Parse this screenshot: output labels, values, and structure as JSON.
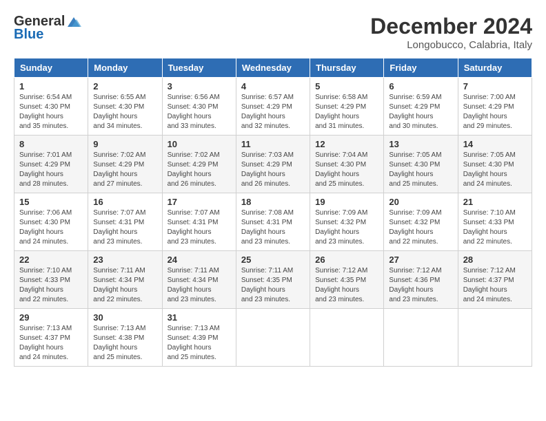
{
  "logo": {
    "general": "General",
    "blue": "Blue"
  },
  "header": {
    "month": "December 2024",
    "location": "Longobucco, Calabria, Italy"
  },
  "weekdays": [
    "Sunday",
    "Monday",
    "Tuesday",
    "Wednesday",
    "Thursday",
    "Friday",
    "Saturday"
  ],
  "weeks": [
    [
      {
        "day": "1",
        "sunrise": "6:54 AM",
        "sunset": "4:30 PM",
        "daylight": "9 hours and 35 minutes."
      },
      {
        "day": "2",
        "sunrise": "6:55 AM",
        "sunset": "4:30 PM",
        "daylight": "9 hours and 34 minutes."
      },
      {
        "day": "3",
        "sunrise": "6:56 AM",
        "sunset": "4:30 PM",
        "daylight": "9 hours and 33 minutes."
      },
      {
        "day": "4",
        "sunrise": "6:57 AM",
        "sunset": "4:29 PM",
        "daylight": "9 hours and 32 minutes."
      },
      {
        "day": "5",
        "sunrise": "6:58 AM",
        "sunset": "4:29 PM",
        "daylight": "9 hours and 31 minutes."
      },
      {
        "day": "6",
        "sunrise": "6:59 AM",
        "sunset": "4:29 PM",
        "daylight": "9 hours and 30 minutes."
      },
      {
        "day": "7",
        "sunrise": "7:00 AM",
        "sunset": "4:29 PM",
        "daylight": "9 hours and 29 minutes."
      }
    ],
    [
      {
        "day": "8",
        "sunrise": "7:01 AM",
        "sunset": "4:29 PM",
        "daylight": "9 hours and 28 minutes."
      },
      {
        "day": "9",
        "sunrise": "7:02 AM",
        "sunset": "4:29 PM",
        "daylight": "9 hours and 27 minutes."
      },
      {
        "day": "10",
        "sunrise": "7:02 AM",
        "sunset": "4:29 PM",
        "daylight": "9 hours and 26 minutes."
      },
      {
        "day": "11",
        "sunrise": "7:03 AM",
        "sunset": "4:29 PM",
        "daylight": "9 hours and 26 minutes."
      },
      {
        "day": "12",
        "sunrise": "7:04 AM",
        "sunset": "4:30 PM",
        "daylight": "9 hours and 25 minutes."
      },
      {
        "day": "13",
        "sunrise": "7:05 AM",
        "sunset": "4:30 PM",
        "daylight": "9 hours and 25 minutes."
      },
      {
        "day": "14",
        "sunrise": "7:05 AM",
        "sunset": "4:30 PM",
        "daylight": "9 hours and 24 minutes."
      }
    ],
    [
      {
        "day": "15",
        "sunrise": "7:06 AM",
        "sunset": "4:30 PM",
        "daylight": "9 hours and 24 minutes."
      },
      {
        "day": "16",
        "sunrise": "7:07 AM",
        "sunset": "4:31 PM",
        "daylight": "9 hours and 23 minutes."
      },
      {
        "day": "17",
        "sunrise": "7:07 AM",
        "sunset": "4:31 PM",
        "daylight": "9 hours and 23 minutes."
      },
      {
        "day": "18",
        "sunrise": "7:08 AM",
        "sunset": "4:31 PM",
        "daylight": "9 hours and 23 minutes."
      },
      {
        "day": "19",
        "sunrise": "7:09 AM",
        "sunset": "4:32 PM",
        "daylight": "9 hours and 23 minutes."
      },
      {
        "day": "20",
        "sunrise": "7:09 AM",
        "sunset": "4:32 PM",
        "daylight": "9 hours and 22 minutes."
      },
      {
        "day": "21",
        "sunrise": "7:10 AM",
        "sunset": "4:33 PM",
        "daylight": "9 hours and 22 minutes."
      }
    ],
    [
      {
        "day": "22",
        "sunrise": "7:10 AM",
        "sunset": "4:33 PM",
        "daylight": "9 hours and 22 minutes."
      },
      {
        "day": "23",
        "sunrise": "7:11 AM",
        "sunset": "4:34 PM",
        "daylight": "9 hours and 22 minutes."
      },
      {
        "day": "24",
        "sunrise": "7:11 AM",
        "sunset": "4:34 PM",
        "daylight": "9 hours and 23 minutes."
      },
      {
        "day": "25",
        "sunrise": "7:11 AM",
        "sunset": "4:35 PM",
        "daylight": "9 hours and 23 minutes."
      },
      {
        "day": "26",
        "sunrise": "7:12 AM",
        "sunset": "4:35 PM",
        "daylight": "9 hours and 23 minutes."
      },
      {
        "day": "27",
        "sunrise": "7:12 AM",
        "sunset": "4:36 PM",
        "daylight": "9 hours and 23 minutes."
      },
      {
        "day": "28",
        "sunrise": "7:12 AM",
        "sunset": "4:37 PM",
        "daylight": "9 hours and 24 minutes."
      }
    ],
    [
      {
        "day": "29",
        "sunrise": "7:13 AM",
        "sunset": "4:37 PM",
        "daylight": "9 hours and 24 minutes."
      },
      {
        "day": "30",
        "sunrise": "7:13 AM",
        "sunset": "4:38 PM",
        "daylight": "9 hours and 25 minutes."
      },
      {
        "day": "31",
        "sunrise": "7:13 AM",
        "sunset": "4:39 PM",
        "daylight": "9 hours and 25 minutes."
      },
      null,
      null,
      null,
      null
    ]
  ],
  "labels": {
    "sunrise": "Sunrise:",
    "sunset": "Sunset:",
    "daylight": "Daylight hours"
  }
}
